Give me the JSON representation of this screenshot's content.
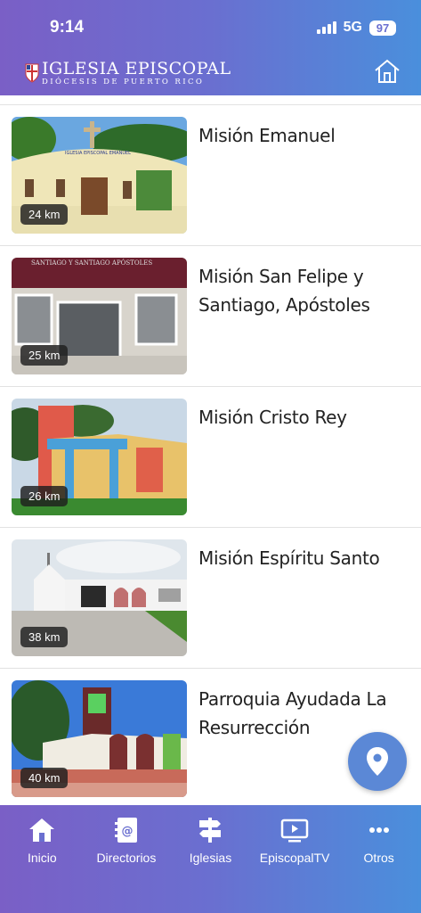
{
  "status_bar": {
    "time": "9:14",
    "network": "5G",
    "battery": "97"
  },
  "header": {
    "brand_title": "IGLESIA EPISCOPAL",
    "brand_subtitle": "DIÓCESIS DE PUERTO RICO",
    "home_icon": "home-icon"
  },
  "churches": [
    {
      "name": "Misión Emanuel",
      "distance": "24 km",
      "photo_sign": "IGLESIA EPISCOPAL EMANUEL"
    },
    {
      "name": "Misión San Felipe y Santiago, Apóstoles",
      "distance": "25 km",
      "photo_sign": "SANTIAGO Y SANTIAGO APÓSTOLES"
    },
    {
      "name": "Misión Cristo Rey",
      "distance": "26 km"
    },
    {
      "name": "Misión Espíritu Santo",
      "distance": "38 km"
    },
    {
      "name": "Parroquia Ayudada La Resurrección",
      "distance": "40 km"
    }
  ],
  "fab": {
    "icon": "location-pin-icon"
  },
  "tabs": [
    {
      "label": "Inicio",
      "icon": "home-icon"
    },
    {
      "label": "Directorios",
      "icon": "address-book-icon"
    },
    {
      "label": "Iglesias",
      "icon": "signpost-icon"
    },
    {
      "label": "EpiscopalTV",
      "icon": "tv-play-icon"
    },
    {
      "label": "Otros",
      "icon": "more-dots-icon"
    }
  ]
}
